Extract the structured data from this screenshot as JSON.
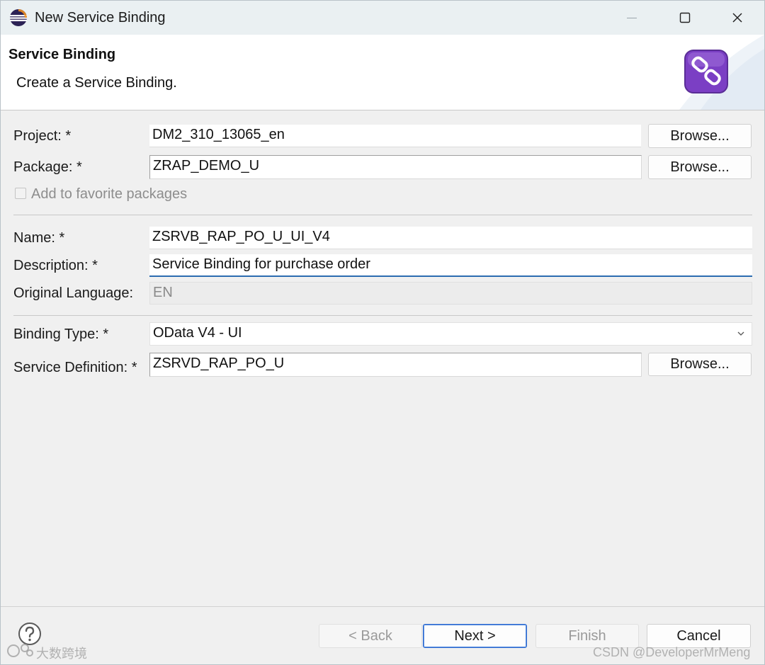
{
  "window": {
    "title": "New Service Binding"
  },
  "banner": {
    "title": "Service Binding",
    "description": "Create a Service Binding."
  },
  "form": {
    "project": {
      "label": "Project: *",
      "value": "DM2_310_13065_en",
      "browse": "Browse..."
    },
    "package": {
      "label": "Package: *",
      "value": "ZRAP_DEMO_U",
      "browse": "Browse..."
    },
    "favorite": {
      "label": "Add to favorite packages",
      "checked": false
    },
    "name": {
      "label": "Name: *",
      "value": "ZSRVB_RAP_PO_U_UI_V4"
    },
    "description": {
      "label": "Description: *",
      "value": "Service Binding for purchase order"
    },
    "language": {
      "label": "Original Language:",
      "value": "EN"
    },
    "binding_type": {
      "label": "Binding Type: *",
      "value": "OData V4 - UI"
    },
    "service_definition": {
      "label": "Service Definition: *",
      "value": "ZSRVD_RAP_PO_U",
      "browse": "Browse..."
    }
  },
  "footer": {
    "back": "< Back",
    "next": "Next >",
    "finish": "Finish",
    "cancel": "Cancel"
  },
  "watermarks": {
    "left": "大数跨境",
    "right": "CSDN @DeveloperMrMeng"
  },
  "colors": {
    "accent": "#2f6bd0",
    "icon_purple": "#7b3fc4"
  }
}
